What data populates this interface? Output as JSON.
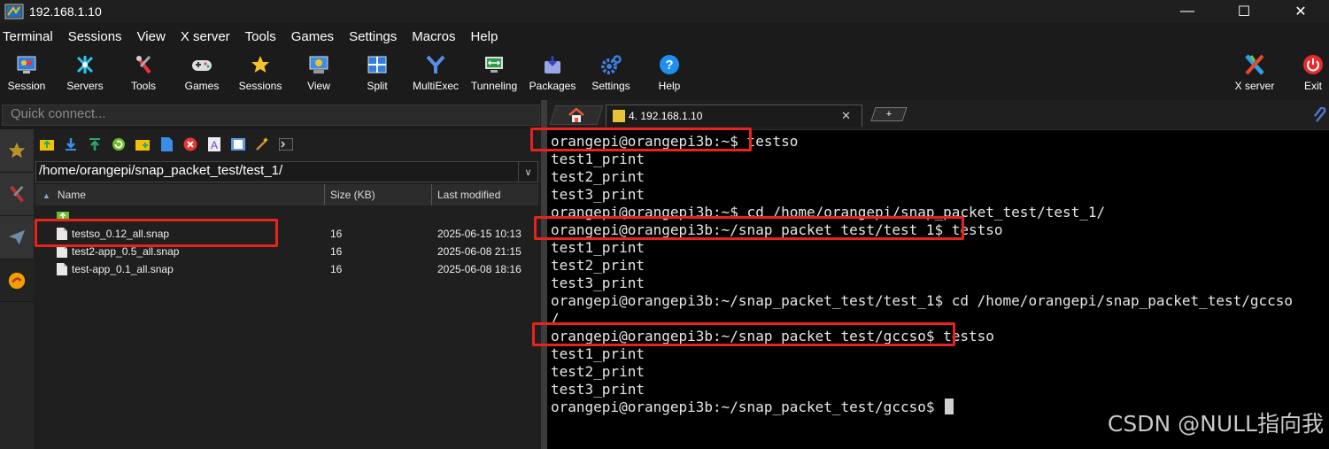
{
  "window": {
    "title": "192.168.1.10",
    "minimize": "—",
    "maximize": "☐",
    "close": "✕"
  },
  "menu": [
    "Terminal",
    "Sessions",
    "View",
    "X server",
    "Tools",
    "Games",
    "Settings",
    "Macros",
    "Help"
  ],
  "toolbar": {
    "session": "Session",
    "servers": "Servers",
    "tools": "Tools",
    "games": "Games",
    "sessions": "Sessions",
    "view": "View",
    "split": "Split",
    "multiexec": "MultiExec",
    "tunneling": "Tunneling",
    "packages": "Packages",
    "settings": "Settings",
    "help": "Help",
    "xserver": "X server",
    "exit": "Exit"
  },
  "quick_connect": {
    "placeholder": "Quick connect..."
  },
  "sftp": {
    "path": "/home/orangepi/snap_packet_test/test_1/",
    "columns": {
      "name": "Name",
      "size": "Size (KB)",
      "modified": "Last modified"
    },
    "files": [
      {
        "name": "testso_0.12_all.snap",
        "size": "16",
        "modified": "2025-06-15 10:13"
      },
      {
        "name": "test2-app_0.5_all.snap",
        "size": "16",
        "modified": "2025-06-08 21:15"
      },
      {
        "name": "test-app_0.1_all.snap",
        "size": "16",
        "modified": "2025-06-08 18:16"
      }
    ]
  },
  "tabs": {
    "session_tab": "4. 192.168.1.10",
    "close": "✕",
    "new": "+"
  },
  "terminal": {
    "lines": [
      "orangepi@orangepi3b:~$ testso",
      "test1_print",
      "test2_print",
      "test3_print",
      "orangepi@orangepi3b:~$ cd /home/orangepi/snap_packet_test/test_1/",
      "orangepi@orangepi3b:~/snap_packet_test/test_1$ testso",
      "test1_print",
      "test2_print",
      "test3_print",
      "orangepi@orangepi3b:~/snap_packet_test/test_1$ cd /home/orangepi/snap_packet_test/gccso",
      "/",
      "orangepi@orangepi3b:~/snap_packet_test/gccso$ testso",
      "test1_print",
      "test2_print",
      "test3_print",
      "orangepi@orangepi3b:~/snap_packet_test/gccso$ "
    ]
  },
  "watermark": "CSDN @NULL指向我",
  "colors": {
    "highlight": "#e8231d",
    "terminal_bg": "#000000"
  }
}
